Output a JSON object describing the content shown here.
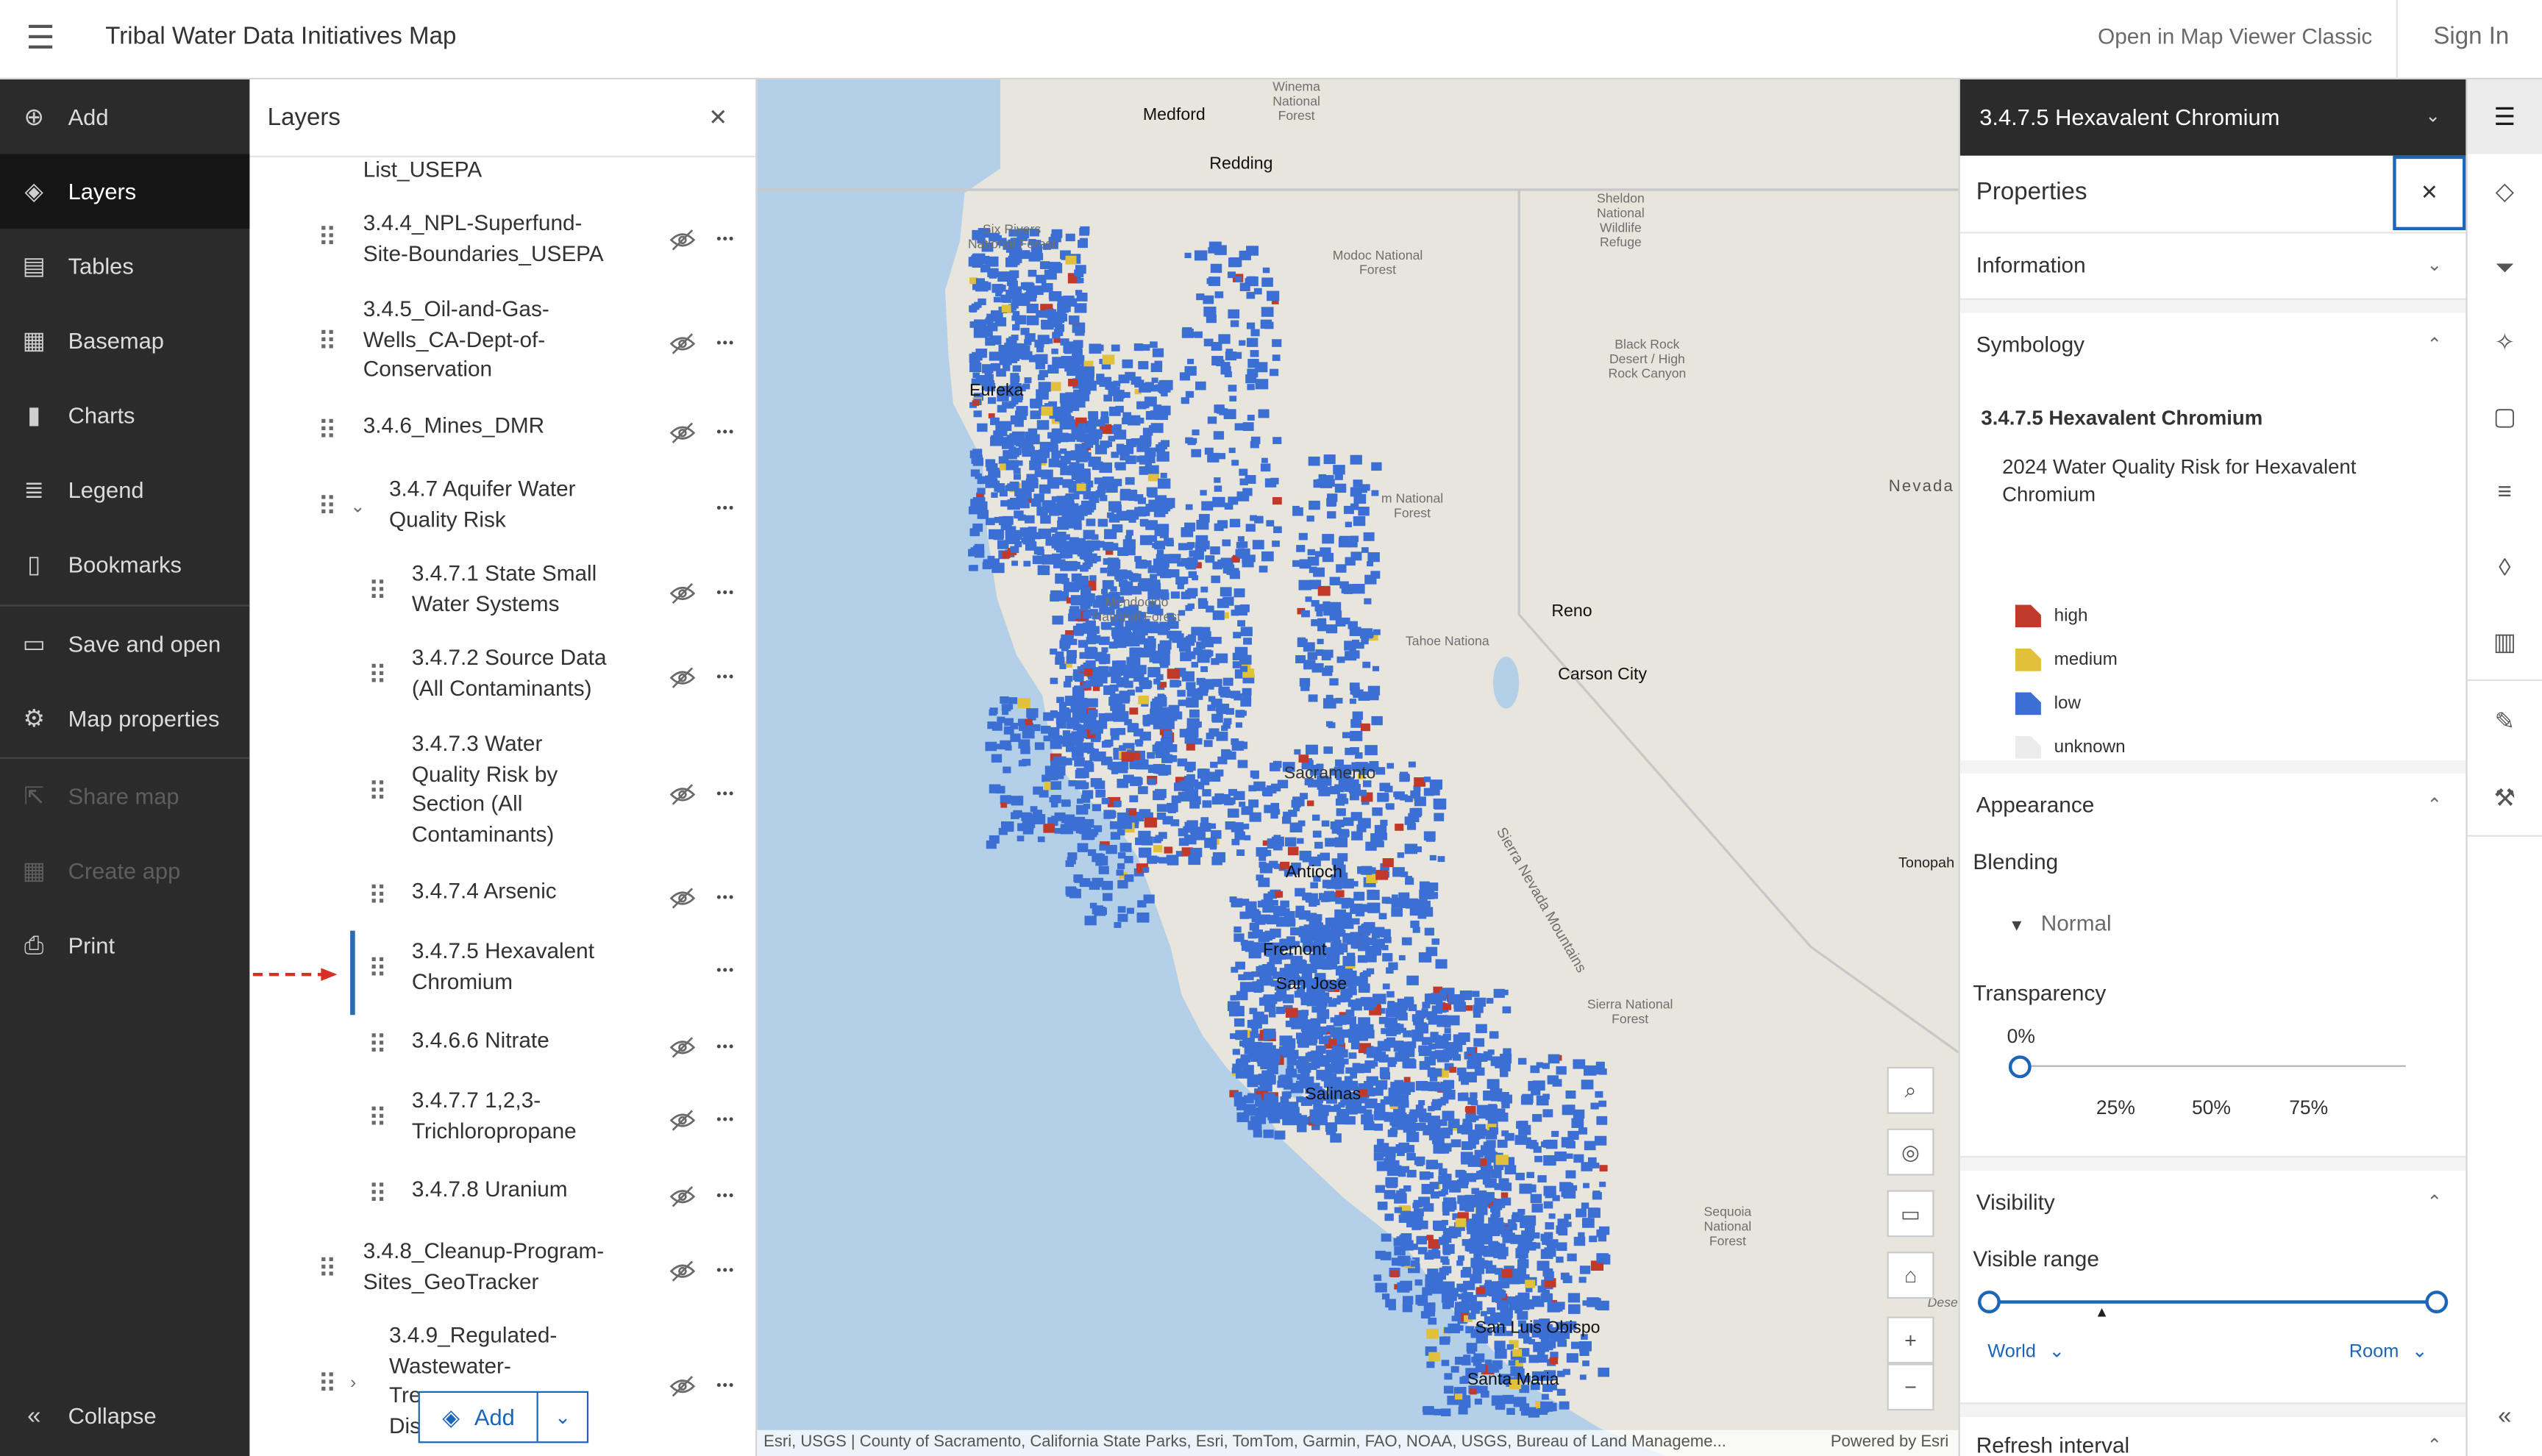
{
  "header": {
    "app_title": "Tribal Water Data Initiatives Map",
    "open_classic": "Open in Map Viewer Classic",
    "sign_in": "Sign In"
  },
  "nav": {
    "add": "Add",
    "layers": "Layers",
    "tables": "Tables",
    "basemap": "Basemap",
    "charts": "Charts",
    "legend": "Legend",
    "bookmarks": "Bookmarks",
    "save_open": "Save and open",
    "map_properties": "Map properties",
    "share_map": "Share map",
    "create_app": "Create app",
    "print": "Print",
    "collapse": "Collapse"
  },
  "layers_panel": {
    "title": "Layers",
    "add_label": "Add",
    "items": [
      {
        "name": "List_USEPA"
      },
      {
        "name": "3.4.4_NPL-Superfund-\nSite-Boundaries_USEPA"
      },
      {
        "name": "3.4.5_Oil-and-Gas-\nWells_CA-Dept-of-\nConservation"
      },
      {
        "name": "3.4.6_Mines_DMR"
      },
      {
        "name": "3.4.7 Aquifer Water\nQuality Risk"
      },
      {
        "name": "3.4.7.1 State Small\nWater Systems"
      },
      {
        "name": "3.4.7.2 Source Data\n(All Contaminants)"
      },
      {
        "name": "3.4.7.3 Water\nQuality Risk by\nSection (All\nContaminants)"
      },
      {
        "name": "3.4.7.4 Arsenic"
      },
      {
        "name": "3.4.7.5 Hexavalent\nChromium"
      },
      {
        "name": "3.4.6.6 Nitrate"
      },
      {
        "name": "3.4.7.7 1,2,3-\nTrichloropropane"
      },
      {
        "name": "3.4.7.8 Uranium"
      },
      {
        "name": "3.4.8_Cleanup-Program-\nSites_GeoTracker"
      },
      {
        "name": "3.4.9_Regulated-\nWastewater-\nTre\nDis"
      }
    ]
  },
  "map": {
    "labels": {
      "medford": "Medford",
      "winema": "Winema\nNational\nForest",
      "six_rivers": "Six Rivers\nNational Forest",
      "modoc": "Modoc National\nForest",
      "sheldon": "Sheldon\nNational\nWildlife\nRefuge",
      "black_rock": "Black Rock\nDesert / High\nRock Canyon",
      "redding": "Redding",
      "eureka": "Eureka",
      "nevada": "Nevada",
      "reno": "Reno",
      "carson": "Carson City",
      "mendocino": "Mendocino\nNational Forest",
      "tahoe": "Tahoe Nationa",
      "plumas": "m National\nForest",
      "sacramento": "Sacramento",
      "sierra_nevada": "Sierra Nevada Mountains",
      "tonopah": "Tonopah",
      "san_jose": "San Jose",
      "fremont": "Fremont",
      "salinas": "Salinas",
      "antioch": "Antioch",
      "sierra_nf": "Sierra National\nForest",
      "sequoia": "Sequoia\nNational\nForest",
      "san_luis": "San Luis Obispo",
      "santa_maria": "Santa Maria",
      "desert": "Dese"
    },
    "attribution": "Esri, USGS | County of Sacramento, California State Parks, Esri, TomTom, Garmin, FAO, NOAA, USGS, Bureau of Land Manageme...",
    "powered_by": "Powered by Esri"
  },
  "properties": {
    "layer_title": "3.4.7.5 Hexavalent Chromium",
    "panel_title": "Properties",
    "information": "Information",
    "symbology": "Symbology",
    "legend_layer": "3.4.7.5 Hexavalent Chromium",
    "legend_field": "2024 Water Quality Risk for Hexavalent\nChromium",
    "legend": [
      {
        "label": "high",
        "color": "#c0392b"
      },
      {
        "label": "medium",
        "color": "#e2c13a"
      },
      {
        "label": "low",
        "color": "#3b6fd4"
      },
      {
        "label": "unknown",
        "color": "#ececec"
      }
    ],
    "appearance": "Appearance",
    "blending_label": "Blending",
    "blending_value": "Normal",
    "transparency_label": "Transparency",
    "transparency_value": "0%",
    "transparency_level": 0,
    "ticks": [
      "25%",
      "50%",
      "75%"
    ],
    "visibility": "Visibility",
    "visible_range_label": "Visible range",
    "range_min": "World",
    "range_max": "Room",
    "refresh_interval": "Refresh interval"
  },
  "colors": {
    "accent": "#1d65b8",
    "nav_bg": "#2b2b2b",
    "low": "#3b6fd4",
    "high": "#c0392b",
    "medium": "#e2c13a"
  }
}
